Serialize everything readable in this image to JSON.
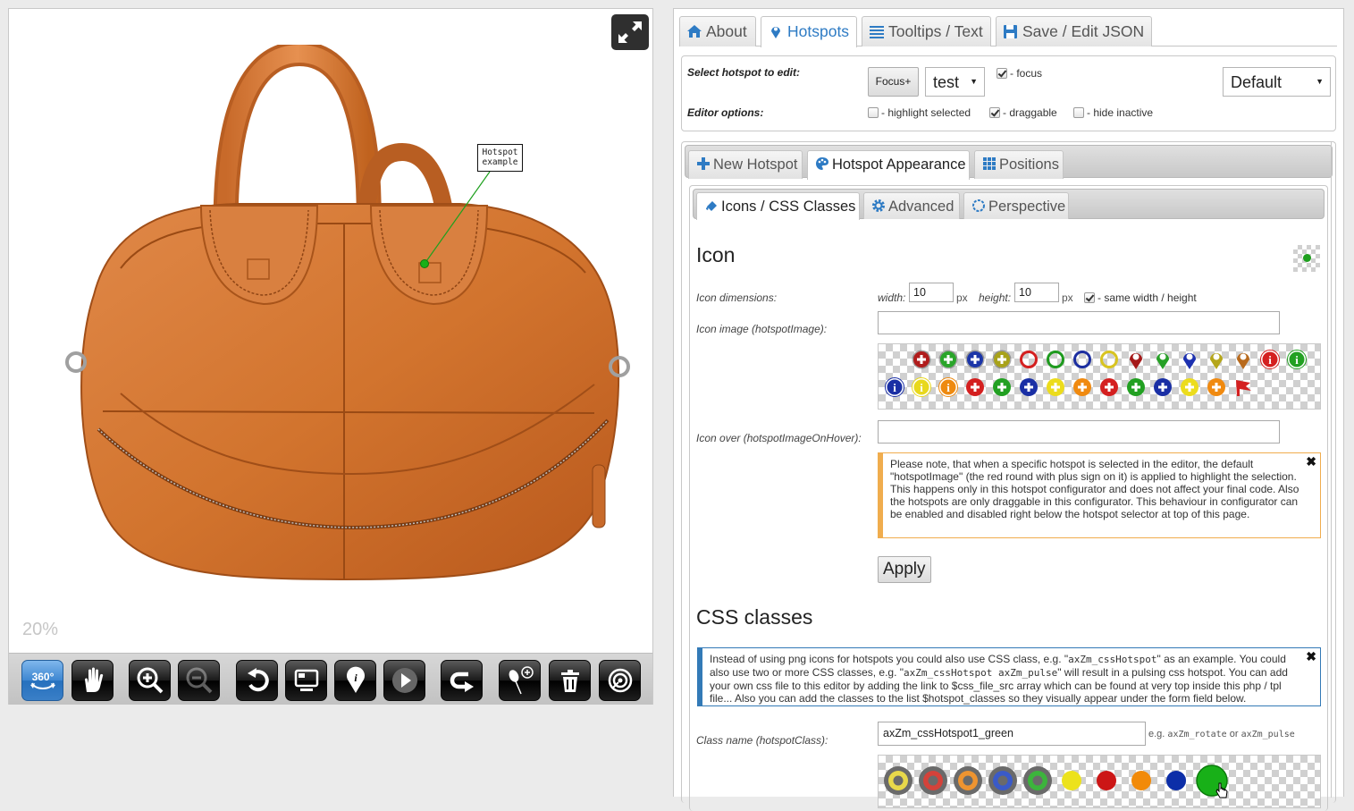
{
  "viewer": {
    "zoom_level": "20%",
    "hotspot_tooltip": [
      "Hotspot",
      "example"
    ],
    "toolbar": [
      {
        "name": "spin-360-button",
        "icon": "360-icon",
        "active": true
      },
      {
        "name": "pan-button",
        "icon": "hand-icon"
      },
      {
        "name": "zoom-in-button",
        "icon": "zoom-in-icon"
      },
      {
        "name": "zoom-out-button",
        "icon": "zoom-out-icon",
        "disabled": true
      },
      {
        "name": "reset-button",
        "icon": "undo-icon"
      },
      {
        "name": "gallery-button",
        "icon": "monitor-icon"
      },
      {
        "name": "hotspots-toggle-button",
        "icon": "info-pin-icon"
      },
      {
        "name": "play-button",
        "icon": "play-icon"
      },
      {
        "name": "rotate-back-button",
        "icon": "return-arrow-icon"
      },
      {
        "name": "add-hotspot-button",
        "icon": "pin-add-icon"
      },
      {
        "name": "delete-hotspot-button",
        "icon": "trash-icon"
      },
      {
        "name": "target-button",
        "icon": "target-icon"
      }
    ]
  },
  "panel": {
    "tabs": [
      {
        "label": "About",
        "icon": "home-icon"
      },
      {
        "label": "Hotspots",
        "icon": "map-marker-icon",
        "active": true
      },
      {
        "label": "Tooltips / Text",
        "icon": "list-icon"
      },
      {
        "label": "Save / Edit JSON",
        "icon": "save-icon"
      }
    ],
    "options": {
      "select_label": "Select hotspot to edit:",
      "focus_button": "Focus+",
      "hotspot_select_value": "test",
      "focus_checkbox_label": "- focus",
      "focus_checked": true,
      "preset_select_value": "Default",
      "editor_label": "Editor options:",
      "editor_checkboxes": [
        {
          "label": "- highlight selected",
          "checked": false
        },
        {
          "label": "- draggable",
          "checked": true
        },
        {
          "label": "- hide inactive",
          "checked": false
        }
      ]
    },
    "sub_tabs": [
      {
        "label": "New Hotspot",
        "icon": "plus-icon"
      },
      {
        "label": "Hotspot Appearance",
        "icon": "palette-icon",
        "active": true
      },
      {
        "label": "Positions",
        "icon": "grid-icon"
      }
    ],
    "inner_tabs": [
      {
        "label": "Icons / CSS Classes",
        "icon": "paint-bucket-icon",
        "active": true
      },
      {
        "label": "Advanced",
        "icon": "gear-icon"
      },
      {
        "label": "Perspective",
        "icon": "circle-dashed-icon"
      }
    ],
    "icon_section": {
      "title": "Icon",
      "dimensions_label": "Icon dimensions:",
      "width_label": "width:",
      "width_value": "10",
      "height_label": "height:",
      "height_value": "10",
      "px_unit": "px",
      "same_wh_label": "- same width / height",
      "same_wh_checked": true,
      "image_label": "Icon image (hotspotImage):",
      "image_value": "",
      "hover_label": "Icon over (hotspotImageOnHover):",
      "hover_value": "",
      "icons_row1": [
        {
          "type": "plus-ball",
          "color": "#b01c1c"
        },
        {
          "type": "plus-ball",
          "color": "#2aa52a"
        },
        {
          "type": "plus-ball",
          "color": "#1c36a8"
        },
        {
          "type": "plus-ball",
          "color": "#a8a21a"
        },
        {
          "type": "ring",
          "color": "#d42020"
        },
        {
          "type": "ring",
          "color": "#1e9a1e"
        },
        {
          "type": "ring",
          "color": "#1c2ea0"
        },
        {
          "type": "ring",
          "color": "#d8c420"
        },
        {
          "type": "pin",
          "color": "#a51818"
        },
        {
          "type": "pin",
          "color": "#26a026"
        },
        {
          "type": "pin",
          "color": "#1c30b0"
        },
        {
          "type": "pin",
          "color": "#b5a61a"
        },
        {
          "type": "pin",
          "color": "#b86a1c"
        },
        {
          "type": "info",
          "color": "#d42020"
        },
        {
          "type": "info",
          "color": "#22a022"
        }
      ],
      "icons_row2": [
        {
          "type": "info",
          "color": "#1a2fa5"
        },
        {
          "type": "info",
          "color": "#e8d81c"
        },
        {
          "type": "info",
          "color": "#ee8a10"
        },
        {
          "type": "plus-flat",
          "color": "#d42020"
        },
        {
          "type": "plus-flat",
          "color": "#22a022"
        },
        {
          "type": "plus-flat",
          "color": "#1a2fa5"
        },
        {
          "type": "plus-flat",
          "color": "#ecdc1c"
        },
        {
          "type": "plus-flat",
          "color": "#f08a10"
        },
        {
          "type": "plus-flat",
          "color": "#d42020"
        },
        {
          "type": "plus-flat",
          "color": "#22a022"
        },
        {
          "type": "plus-flat",
          "color": "#1a2fa5"
        },
        {
          "type": "plus-flat",
          "color": "#ecdc1c"
        },
        {
          "type": "plus-flat",
          "color": "#f08a10"
        },
        {
          "type": "flag",
          "color": "#d42020"
        }
      ],
      "preview_color": "#1ea01e",
      "warning_note": "Please note, that when a specific hotspot is selected in the editor, the default \"hotspotImage\" (the red round with plus sign on it) is applied to highlight the selection. This happens only in this hotspot configurator and does not affect your final code. Also the hotspots are only draggable in this configurator. This behaviour in configurator can be enabled and disabled right below the hotspot selector at top of this page.",
      "apply_button": "Apply"
    },
    "css_section": {
      "title": "CSS classes",
      "info_note_parts": [
        "Instead of using png icons for hotspots you could also use CSS class, e.g. \"",
        "axZm_cssHotspot",
        "\" as an example. You could also use two or more CSS classes, e.g. \"",
        "axZm_cssHotspot axZm_pulse",
        "\" will result in a pulsing css hotspot. You can add your own css file to this editor by adding the link to $css_file_src array which can be found at very top inside this php / tpl file... Also you can add the classes to the list $hotspot_classes so they visually appear under the form field below."
      ],
      "class_label": "Class name (hotspotClass):",
      "class_value": "axZm_cssHotspot1_green",
      "hint_prefix": "e.g.",
      "hint_a": "axZm_rotate",
      "hint_or": "or",
      "hint_b": "axZm_pulse",
      "css_swatches": [
        {
          "type": "ring",
          "color": "#e8d84a"
        },
        {
          "type": "ring",
          "color": "#d4423a"
        },
        {
          "type": "ring",
          "color": "#ee9430"
        },
        {
          "type": "ring",
          "color": "#3a5ac8"
        },
        {
          "type": "ring",
          "color": "#3cb43c"
        },
        {
          "type": "dot",
          "color": "#ece21c"
        },
        {
          "type": "dot",
          "color": "#cc1616"
        },
        {
          "type": "dot",
          "color": "#f28a08"
        },
        {
          "type": "dot",
          "color": "#0c2ea8"
        },
        {
          "type": "dot-large",
          "color": "#18b018",
          "selected": true
        }
      ]
    }
  }
}
